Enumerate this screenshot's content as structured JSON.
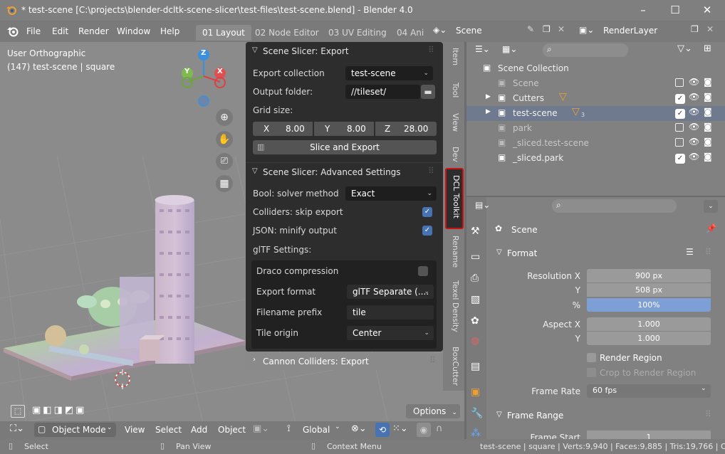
{
  "titlebar": {
    "title": "* test-scene [C:\\projects\\blender-dcltk-scene-slicer\\test-files\\test-scene.blend] - Blender 4.0",
    "minimize": "–",
    "maximize": "☐",
    "close": "✕"
  },
  "menu": {
    "items": [
      "File",
      "Edit",
      "Render",
      "Window",
      "Help"
    ]
  },
  "workspaces": [
    "01 Layout",
    "02 Node Editor",
    "03 UV Editing",
    "04 Ani"
  ],
  "scene": {
    "label": "Scene",
    "render_layer": "RenderLayer"
  },
  "viewport": {
    "view_label": "User Orthographic",
    "object_label": "(147) test-scene | square",
    "mode": "Object Mode",
    "menu": [
      "View",
      "Select",
      "Add",
      "Object"
    ],
    "orientation": "Global",
    "options": "Options",
    "gizmo": {
      "z": "Z",
      "y": "Y",
      "x": "X"
    }
  },
  "panel_export": {
    "header": "Scene Slicer: Export",
    "export_collection_label": "Export collection",
    "export_collection_value": "test-scene",
    "output_folder_label": "Output folder:",
    "output_folder_value": "//tileset/",
    "grid_size_label": "Grid size:",
    "grid": [
      {
        "axis": "X",
        "value": "8.00"
      },
      {
        "axis": "Y",
        "value": "8.00"
      },
      {
        "axis": "Z",
        "value": "28.00"
      }
    ],
    "slice_button": "Slice and Export"
  },
  "panel_adv": {
    "header": "Scene Slicer: Advanced Settings",
    "bool_label": "Bool: solver method",
    "bool_value": "Exact",
    "colliders_label": "Colliders:  skip export",
    "json_label": "JSON: minify output",
    "gltf_label": "glTF Settings:",
    "draco_label": "Draco compression",
    "export_format_label": "Export format",
    "export_format_value": "glTF Separate (....",
    "prefix_label": "Filename prefix",
    "prefix_value": "tile",
    "origin_label": "Tile origin",
    "origin_value": "Center"
  },
  "panel_cannon": {
    "header": "Cannon Colliders: Export"
  },
  "sidebar_tabs": [
    "Item",
    "Tool",
    "View",
    "Dev",
    "DCL Toolkit",
    "Rename",
    "Texel Density",
    "BoxCutter"
  ],
  "outliner": {
    "root": "Scene Collection",
    "rows": [
      {
        "name": "Scene"
      },
      {
        "name": "Cutters"
      },
      {
        "name": "test-scene",
        "badge": "3"
      },
      {
        "name": "park"
      },
      {
        "name": "_sliced.test-scene"
      },
      {
        "name": "_sliced.park"
      }
    ]
  },
  "properties": {
    "scene_name": "Scene",
    "format_header": "Format",
    "resolution_x_label": "Resolution X",
    "resolution_x": "900 px",
    "resolution_y_label": "Y",
    "resolution_y": "508 px",
    "percent_label": "%",
    "percent": "100%",
    "aspect_x_label": "Aspect X",
    "aspect_x": "1.000",
    "aspect_y_label": "Y",
    "aspect_y": "1.000",
    "render_region": "Render Region",
    "crop_region": "Crop to Render Region",
    "frame_rate_label": "Frame Rate",
    "frame_rate": "60 fps",
    "frame_range_header": "Frame Range",
    "frame_start_label": "Frame Start",
    "frame_start": "1"
  },
  "statusbar": {
    "select": "Select",
    "pan": "Pan View",
    "context": "Context Menu",
    "stats": "test-scene | square | Verts:9,940 | Faces:9,885 | Tris:19,766 | O"
  },
  "colors": {
    "accent": "#4772b3",
    "highlight": "#cc1111",
    "panel": "#2d2d2d"
  }
}
